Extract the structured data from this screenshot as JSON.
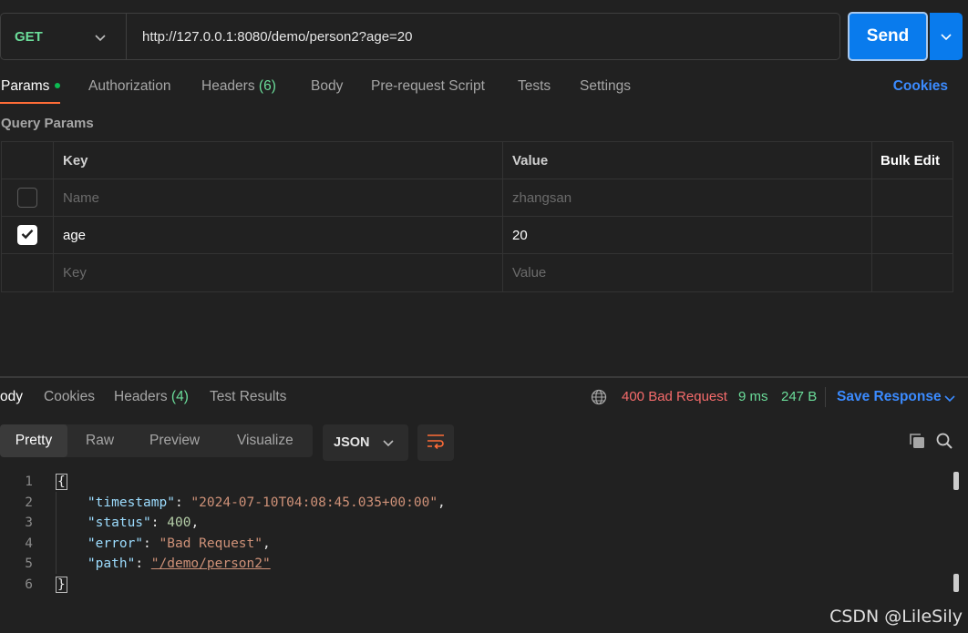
{
  "request": {
    "method": "GET",
    "url": "http://127.0.0.1:8080/demo/person2?age=20",
    "send_label": "Send"
  },
  "request_tabs": {
    "params": "Params",
    "authorization": "Authorization",
    "headers": "Headers",
    "headers_count": "(6)",
    "body": "Body",
    "pre_request": "Pre-request Script",
    "tests": "Tests",
    "settings": "Settings",
    "cookies": "Cookies"
  },
  "query_params": {
    "title": "Query Params",
    "headers": {
      "key": "Key",
      "value": "Value",
      "bulk_edit": "Bulk Edit"
    },
    "rows": [
      {
        "checked": false,
        "key_placeholder": "Name",
        "value_placeholder": "zhangsan"
      },
      {
        "checked": true,
        "key": "age",
        "value": "20"
      },
      {
        "checked": null,
        "key_placeholder": "Key",
        "value_placeholder": "Value"
      }
    ]
  },
  "response_tabs": {
    "body": "ody",
    "cookies": "Cookies",
    "headers": "Headers",
    "headers_count": "(4)",
    "test_results": "Test Results"
  },
  "response_meta": {
    "status": "400 Bad Request",
    "time": "9 ms",
    "size": "247 B",
    "save_response": "Save Response",
    "status_color": "#f56b6b"
  },
  "view_modes": {
    "pretty": "Pretty",
    "raw": "Raw",
    "preview": "Preview",
    "visualize": "Visualize"
  },
  "format": "JSON",
  "code": {
    "line_numbers": [
      "1",
      "2",
      "3",
      "4",
      "5",
      "6"
    ],
    "open_brace": "{",
    "close_brace": "}",
    "fields": [
      {
        "key": "\"timestamp\"",
        "value": "\"2024-07-10T04:08:45.035+00:00\""
      },
      {
        "key": "\"status\"",
        "value": "400"
      },
      {
        "key": "\"error\"",
        "value": "\"Bad Request\""
      },
      {
        "key": "\"path\"",
        "value": "\"/demo/person2\""
      }
    ]
  },
  "watermark": "CSDN @LileSily",
  "colors": {
    "accent": "#097bed",
    "tab_underline": "#ff6c37",
    "link": "#3b8bff",
    "success": "#6bdd9a"
  }
}
